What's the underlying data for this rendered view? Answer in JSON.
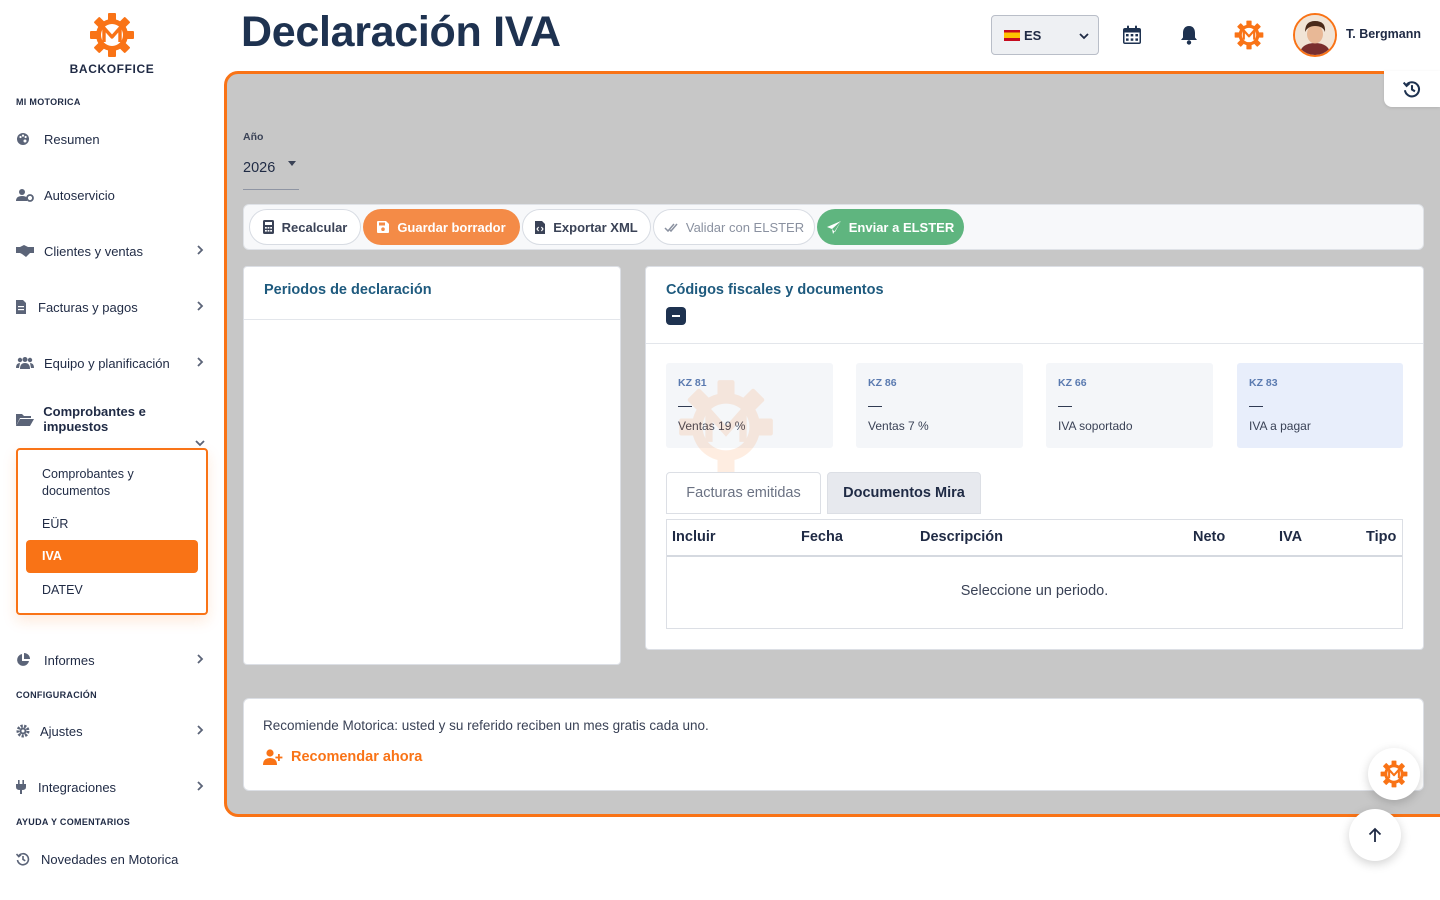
{
  "brand": {
    "logo_text": "BACKOFFICE",
    "accent": "#f97316"
  },
  "header": {
    "title": "Declaración IVA",
    "language": "ES",
    "user_name": "T. Bergmann"
  },
  "sidebar": {
    "sections": [
      "MI MOTORICA",
      "CONFIGURACIÓN",
      "AYUDA Y COMENTARIOS"
    ],
    "items": [
      {
        "label": "Resumen",
        "icon": "palette-icon"
      },
      {
        "label": "Autoservicio",
        "icon": "user-gear-icon"
      },
      {
        "label": "Clientes y ventas",
        "icon": "handshake-icon"
      },
      {
        "label": "Facturas y pagos",
        "icon": "invoice-icon"
      },
      {
        "label": "Equipo y planificación",
        "icon": "users-icon"
      },
      {
        "label": "Comprobantes e impuestos",
        "icon": "folder-open-icon"
      },
      {
        "label": "Informes",
        "icon": "pie-chart-icon"
      },
      {
        "label": "Ajustes",
        "icon": "gear-icon"
      },
      {
        "label": "Integraciones",
        "icon": "plug-icon"
      },
      {
        "label": "Novedades en Motorica",
        "icon": "history-icon"
      }
    ],
    "submenu": [
      "Comprobantes y documentos",
      "EÜR",
      "IVA",
      "DATEV"
    ]
  },
  "filters": {
    "year_label": "Año",
    "year_value": "2026"
  },
  "toolbar": {
    "recalc": "Recalcular",
    "save_draft": "Guardar borrador",
    "export_xml": "Exportar XML",
    "validate": "Validar con ELSTER",
    "send": "Enviar a ELSTER"
  },
  "periods": {
    "title": "Periodos de declaración"
  },
  "codes": {
    "title": "Códigos fiscales y documentos",
    "kpis": [
      {
        "code": "KZ 81",
        "value": "—",
        "label": "Ventas 19 %"
      },
      {
        "code": "KZ 86",
        "value": "—",
        "label": "Ventas 7 %"
      },
      {
        "code": "KZ 66",
        "value": "—",
        "label": "IVA soportado"
      },
      {
        "code": "KZ 83",
        "value": "—",
        "label": "IVA a pagar"
      }
    ],
    "tabs": [
      "Facturas emitidas",
      "Documentos Mira"
    ],
    "columns": [
      "Incluir",
      "Fecha",
      "Descripción",
      "Neto",
      "IVA",
      "Tipo"
    ],
    "empty": "Seleccione un periodo."
  },
  "referral": {
    "text": "Recomiende Motorica: usted y su referido reciben un mes gratis cada uno.",
    "link": "Recomendar ahora"
  }
}
